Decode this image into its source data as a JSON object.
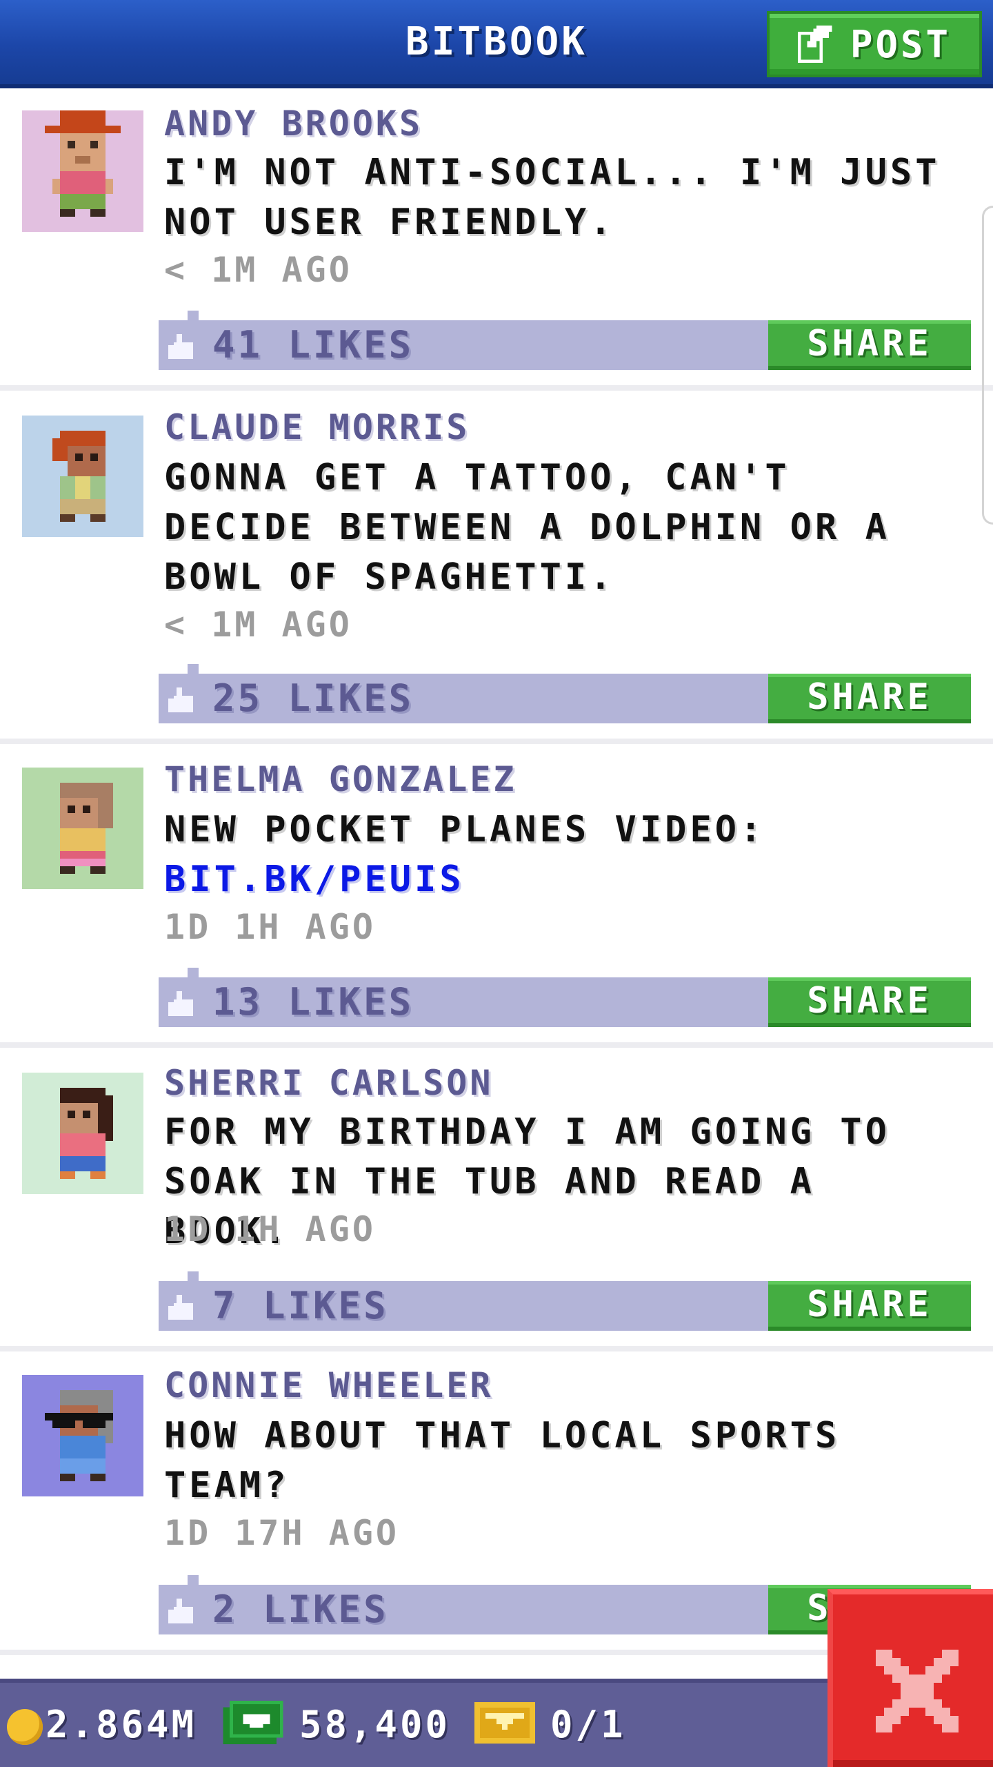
{
  "header": {
    "title": "BITBOOK",
    "post_label": "POST",
    "post_icon": "compose-icon"
  },
  "posts": [
    {
      "author": "ANDY BROOKS",
      "text": "I'M NOT ANTI-SOCIAL... I'M JUST NOT USER FRIENDLY.",
      "link": "",
      "time": "< 1M AGO",
      "likes": "41 LIKES",
      "share_label": "SHARE",
      "avatar_bg": "#e2c0e0"
    },
    {
      "author": "CLAUDE MORRIS",
      "text": "GONNA GET A TATTOO, CAN'T DECIDE BETWEEN A DOLPHIN OR A BOWL OF SPAGHETTI.",
      "link": "",
      "time": "< 1M AGO",
      "likes": "25 LIKES",
      "share_label": "SHARE",
      "avatar_bg": "#bcd3ea"
    },
    {
      "author": "THELMA GONZALEZ",
      "text": "NEW POCKET PLANES VIDEO:",
      "link": "BIT.BK/PEUIS",
      "time": "1D 1H AGO",
      "likes": "13 LIKES",
      "share_label": "SHARE",
      "avatar_bg": "#b4d9a8"
    },
    {
      "author": "SHERRI CARLSON",
      "text": "FOR MY BIRTHDAY I AM GOING TO SOAK IN THE TUB AND READ A BOOK.",
      "link": "",
      "time": "1D 1H AGO",
      "likes": "7 LIKES",
      "share_label": "SHARE",
      "avatar_bg": "#d1ecd6"
    },
    {
      "author": "CONNIE WHEELER",
      "text": "HOW ABOUT THAT LOCAL SPORTS TEAM?",
      "link": "",
      "time": "1D 17H AGO",
      "likes": "2 LIKES",
      "share_label": "SHARE",
      "avatar_bg": "#8b86e0"
    }
  ],
  "status_bar": {
    "coins": "2.864M",
    "bux": "58,400",
    "tickets": "0/1",
    "coin_icon": "coin-icon",
    "bux_icon": "cash-icon",
    "ticket_icon": "ticket-icon"
  },
  "close_icon": "close-icon",
  "colors": {
    "header_blue": "#1c46a8",
    "share_green": "#44ad41",
    "like_bar": "#b3b4d8",
    "author_purple": "#5c5a92",
    "link_blue": "#0b19e6",
    "close_red": "#e42a2a"
  }
}
